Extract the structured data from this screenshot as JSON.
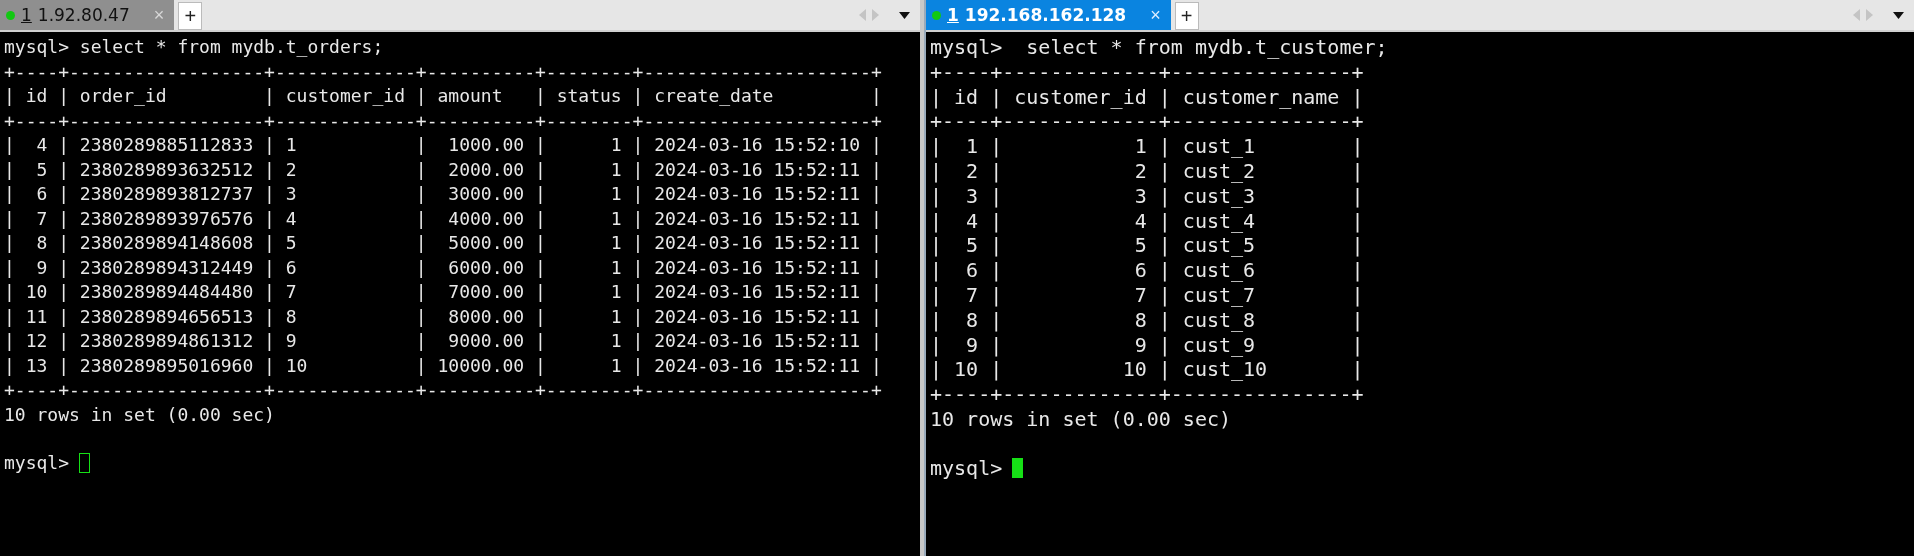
{
  "panes": [
    {
      "tab": {
        "number": "1",
        "host": "1.92.80.47",
        "close": "×",
        "selected": false
      },
      "new_tab": "+",
      "focused": false,
      "lines": [
        "mysql> select * from mydb.t_orders;",
        "+----+------------------+-------------+----------+--------+---------------------+",
        "| id | order_id         | customer_id | amount   | status | create_date         |",
        "+----+------------------+-------------+----------+--------+---------------------+",
        "|  4 | 2380289885112833 | 1           |  1000.00 |      1 | 2024-03-16 15:52:10 |",
        "|  5 | 2380289893632512 | 2           |  2000.00 |      1 | 2024-03-16 15:52:11 |",
        "|  6 | 2380289893812737 | 3           |  3000.00 |      1 | 2024-03-16 15:52:11 |",
        "|  7 | 2380289893976576 | 4           |  4000.00 |      1 | 2024-03-16 15:52:11 |",
        "|  8 | 2380289894148608 | 5           |  5000.00 |      1 | 2024-03-16 15:52:11 |",
        "|  9 | 2380289894312449 | 6           |  6000.00 |      1 | 2024-03-16 15:52:11 |",
        "| 10 | 2380289894484480 | 7           |  7000.00 |      1 | 2024-03-16 15:52:11 |",
        "| 11 | 2380289894656513 | 8           |  8000.00 |      1 | 2024-03-16 15:52:11 |",
        "| 12 | 2380289894861312 | 9           |  9000.00 |      1 | 2024-03-16 15:52:11 |",
        "| 13 | 2380289895016960 | 10          | 10000.00 |      1 | 2024-03-16 15:52:11 |",
        "+----+------------------+-------------+----------+--------+---------------------+",
        "10 rows in set (0.00 sec)"
      ],
      "prompt": "mysql>"
    },
    {
      "tab": {
        "number": "1",
        "host": "192.168.162.128",
        "close": "×",
        "selected": true
      },
      "new_tab": "+",
      "focused": true,
      "lines": [
        "mysql>  select * from mydb.t_customer;",
        "+----+-------------+---------------+",
        "| id | customer_id | customer_name |",
        "+----+-------------+---------------+",
        "|  1 |           1 | cust_1        |",
        "|  2 |           2 | cust_2        |",
        "|  3 |           3 | cust_3        |",
        "|  4 |           4 | cust_4        |",
        "|  5 |           5 | cust_5        |",
        "|  6 |           6 | cust_6        |",
        "|  7 |           7 | cust_7        |",
        "|  8 |           8 | cust_8        |",
        "|  9 |           9 | cust_9        |",
        "| 10 |          10 | cust_10       |",
        "+----+-------------+---------------+",
        "10 rows in set (0.00 sec)"
      ],
      "prompt": "mysql>"
    }
  ]
}
